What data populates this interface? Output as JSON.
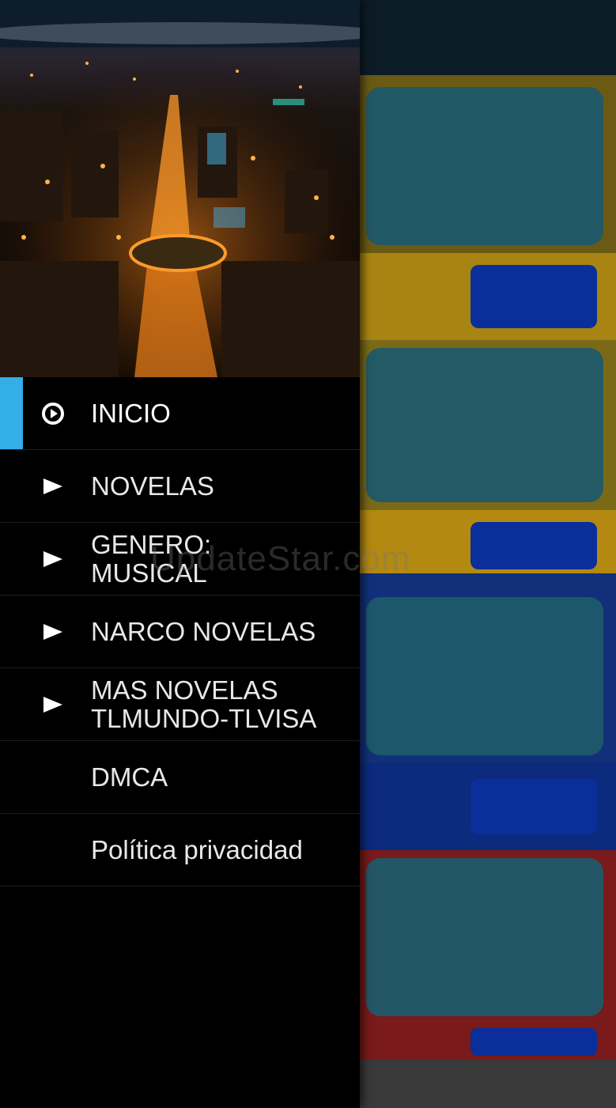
{
  "drawer": {
    "menu": [
      {
        "label": "INICIO",
        "icon": "play-circle-icon",
        "active": true
      },
      {
        "label": "NOVELAS",
        "icon": "play-arrow-icon"
      },
      {
        "label": "GENERO:\nMUSICAL",
        "icon": "play-arrow-icon"
      },
      {
        "label": "NARCO NOVELAS",
        "icon": "play-arrow-icon"
      },
      {
        "label": "MAS NOVELAS\nTLMUNDO-TLVISA",
        "icon": "play-arrow-icon"
      },
      {
        "label": "DMCA"
      },
      {
        "label": "Política privacidad"
      }
    ]
  },
  "watermark": "UpdateStar.com",
  "colors": {
    "accent": "#33aee6",
    "drawer_bg": "#000000",
    "text": "#e8e8e8"
  }
}
